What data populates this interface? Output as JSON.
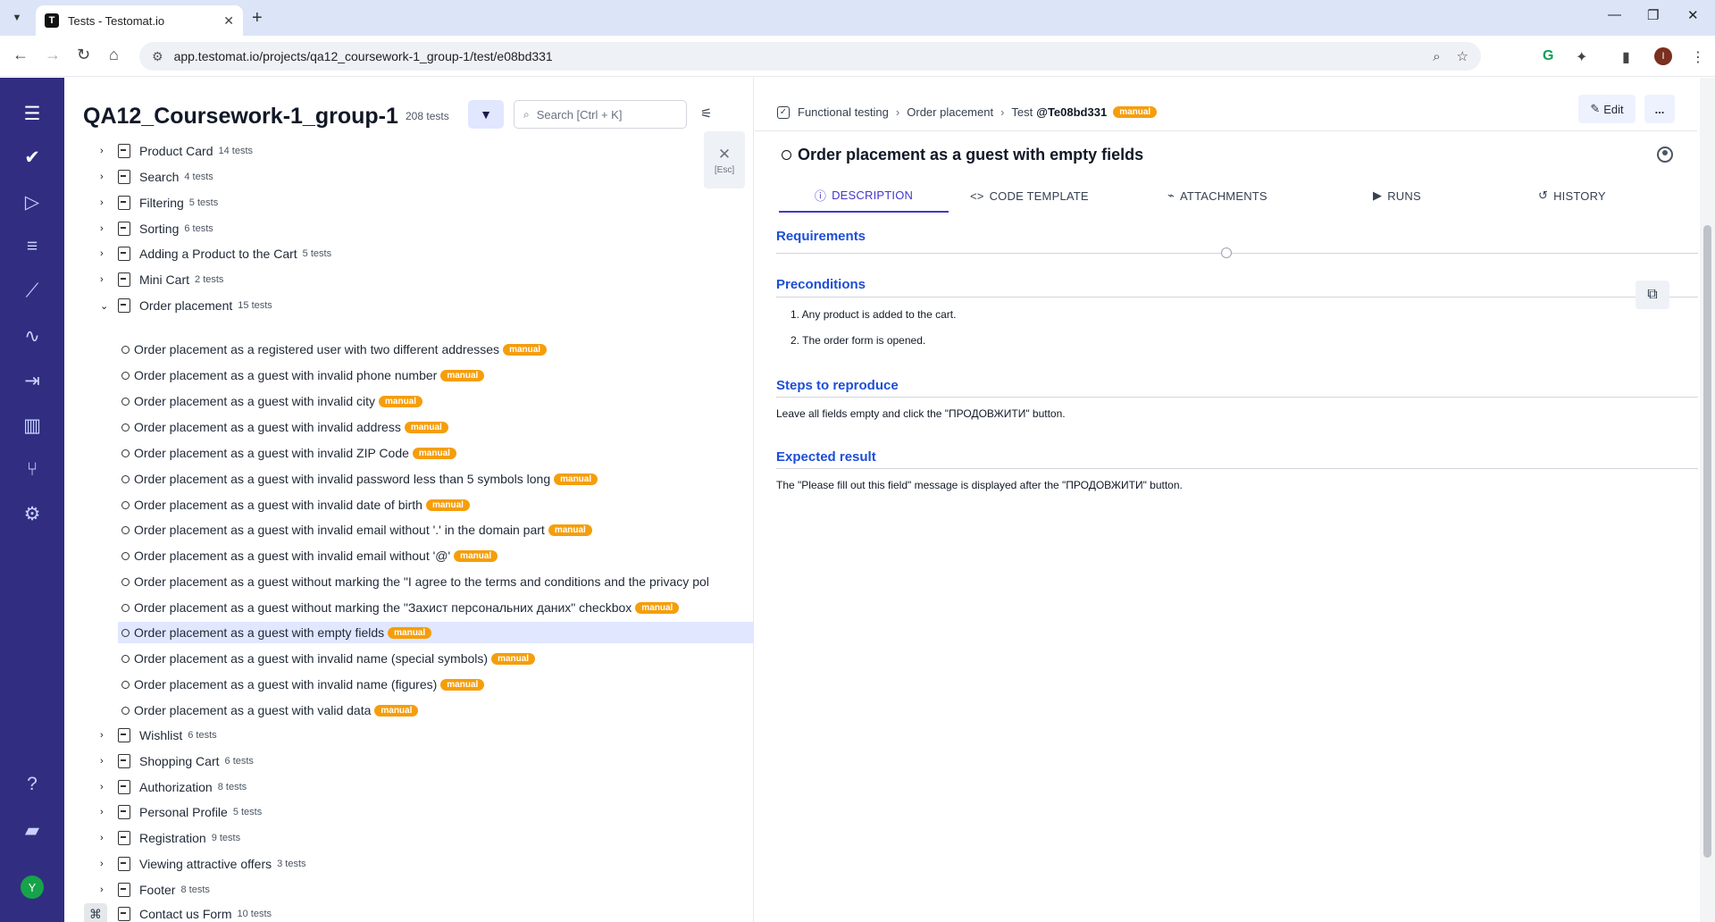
{
  "browser": {
    "tab_title": "Tests - Testomat.io",
    "favicon": "T",
    "url": "app.testomat.io/projects/qa12_coursework-1_group-1/test/e08bd331"
  },
  "app_nav": {
    "avatar_letter": "Y",
    "accent": "#312e81"
  },
  "tree": {
    "project_title": "QA12_Coursework-1_group-1",
    "test_count": "208 tests",
    "search_placeholder": "Search [Ctrl + K]",
    "esc_label": "[Esc]",
    "suites_before": [
      {
        "name": "Product Card",
        "count": "14 tests"
      },
      {
        "name": "Search",
        "count": "4 tests"
      },
      {
        "name": "Filtering",
        "count": "5 tests"
      },
      {
        "name": "Sorting",
        "count": "6 tests"
      },
      {
        "name": "Adding a Product to the Cart",
        "count": "5 tests"
      },
      {
        "name": "Mini Cart",
        "count": "2 tests"
      },
      {
        "name": "Order placement",
        "count": "15 tests"
      }
    ],
    "tests": [
      {
        "name": "Order placement as a registered user with two different addresses",
        "badge": "manual"
      },
      {
        "name": "Order placement as a guest with invalid phone number",
        "badge": "manual"
      },
      {
        "name": "Order placement as a guest with invalid city",
        "badge": "manual"
      },
      {
        "name": "Order placement as a guest with invalid address",
        "badge": "manual"
      },
      {
        "name": "Order placement as a guest with invalid ZIP Code",
        "badge": "manual"
      },
      {
        "name": "Order placement as a guest with invalid password less than 5 symbols long",
        "badge": "manual"
      },
      {
        "name": "Order placement as a guest with invalid date of birth",
        "badge": "manual"
      },
      {
        "name": "Order placement as a guest with invalid email without '.' in the domain part",
        "badge": "manual"
      },
      {
        "name": "Order placement as a guest with invalid email without '@'",
        "badge": "manual"
      },
      {
        "name": "Order placement as a guest without marking the \"I agree to the terms and conditions and the privacy pol",
        "badge": ""
      },
      {
        "name": "Order placement as a guest without marking the \"Захист персональних даних\" checkbox",
        "badge": "manual"
      },
      {
        "name": "Order placement as a guest with empty fields",
        "badge": "manual"
      },
      {
        "name": "Order placement as a guest with invalid name (special symbols)",
        "badge": "manual"
      },
      {
        "name": "Order placement as a guest with invalid name (figures)",
        "badge": "manual"
      },
      {
        "name": "Order placement as a guest with valid data",
        "badge": "manual"
      }
    ],
    "suites_after": [
      {
        "name": "Wishlist",
        "count": "6 tests"
      },
      {
        "name": "Shopping Cart",
        "count": "6 tests"
      },
      {
        "name": "Authorization",
        "count": "8 tests"
      },
      {
        "name": "Personal Profile",
        "count": "5 tests"
      },
      {
        "name": "Registration",
        "count": "9 tests"
      },
      {
        "name": "Viewing attractive offers",
        "count": "3 tests"
      },
      {
        "name": "Footer",
        "count": "8 tests"
      },
      {
        "name": "Contact us Form",
        "count": "10 tests"
      }
    ]
  },
  "detail": {
    "breadcrumb": {
      "suite_group": "Functional testing",
      "suite": "Order placement",
      "test_prefix": "Test",
      "test_id": "@Te08bd331",
      "badge": "manual"
    },
    "edit_label": "Edit",
    "more_label": "...",
    "title": "Order placement as a guest with empty fields",
    "tabs": {
      "description": "DESCRIPTION",
      "code_template": "CODE TEMPLATE",
      "attachments": "ATTACHMENTS",
      "runs": "RUNS",
      "history": "HISTORY"
    },
    "requirements_h": "Requirements",
    "preconditions_h": "Preconditions",
    "preconditions": [
      "1. Any product is added to the cart.",
      "2. The order form is opened."
    ],
    "steps_h": "Steps to reproduce",
    "steps": "Leave all fields empty and click the \"ПРОДОВЖИТИ\" button.",
    "expected_h": "Expected result",
    "expected": "The \"Please fill out this field\" message is displayed after the \"ПРОДОВЖИТИ\" button."
  },
  "colors": {
    "badge": "#f59e0b",
    "link_heading": "#1d4ed8",
    "selected_row": "#e0e7ff"
  }
}
